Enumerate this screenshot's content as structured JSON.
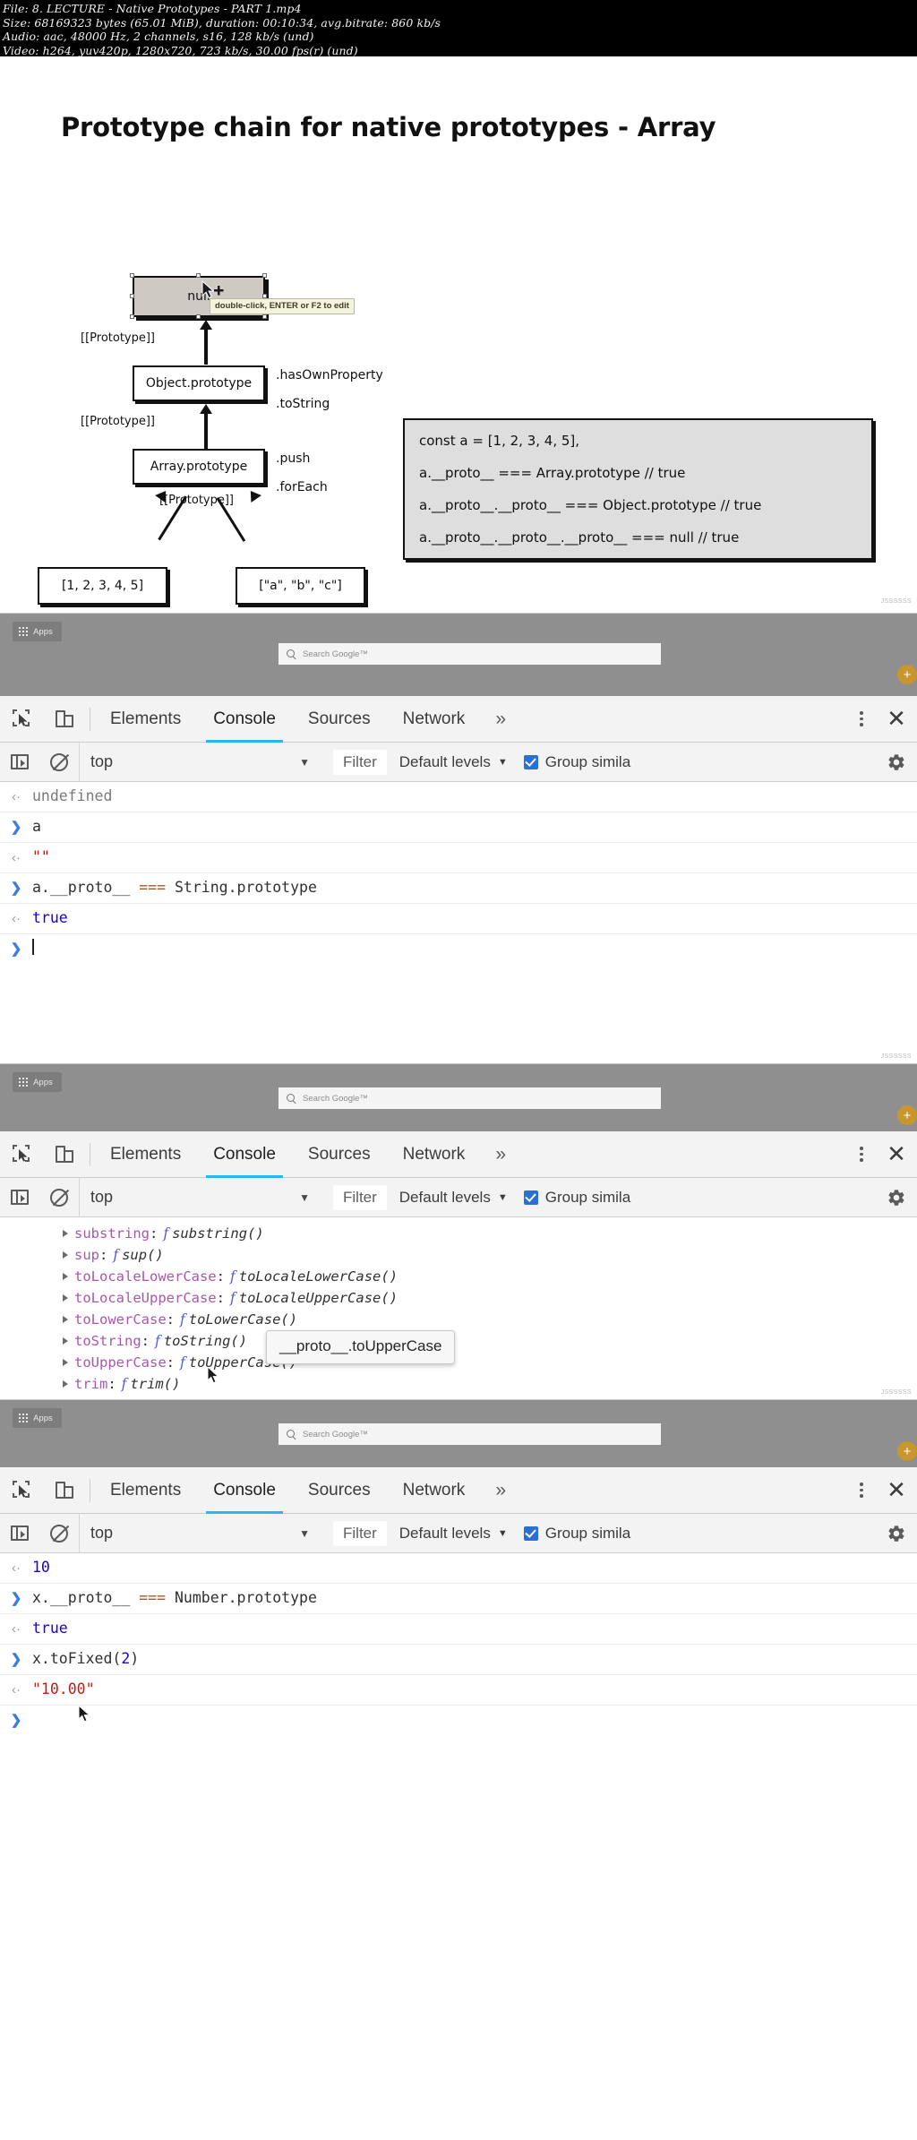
{
  "fileinfo": {
    "line1": "File: 8. LECTURE - Native Prototypes - PART 1.mp4",
    "line2": "Size: 68169323 bytes (65.01 MiB), duration: 00:10:34, avg.bitrate: 860 kb/s",
    "line3": "Audio: aac, 48000 Hz, 2 channels, s16, 128 kb/s (und)",
    "line4": "Video: h264, yuv420p, 1280x720, 723 kb/s, 30.00 fps(r) (und)"
  },
  "slide": {
    "title": "Prototype chain for native prototypes - Array",
    "boxes": {
      "null": "null",
      "object_prototype": "Object.prototype",
      "array_prototype": "Array.prototype",
      "array_numbers": "[1, 2, 3, 4, 5]",
      "array_strings": "[\"a\", \"b\", \"c\"]"
    },
    "edges": {
      "proto1": "[[Prototype]]",
      "proto2": "[[Prototype]]",
      "proto3": "[[Prototype]]"
    },
    "methods": {
      "has_own_property": ".hasOwnProperty",
      "to_string": ".toString",
      "push": ".push",
      "for_each": ".forEach"
    },
    "tooltip": "double-click, ENTER or F2 to edit",
    "code_lines": [
      "const a = [1, 2, 3, 4, 5],",
      "a.__proto__ === Array.prototype // true",
      "a.__proto__.__proto__ === Object.prototype // true",
      "a.__proto__.__proto__.__proto__ === null // true"
    ],
    "watermark": "JSSSSSS"
  },
  "browser": {
    "apps_label": "Apps",
    "search_placeholder": "Search Google™"
  },
  "devtools": {
    "tabs": [
      "Elements",
      "Console",
      "Sources",
      "Network"
    ],
    "active_tab": "Console",
    "more_tabs": "»",
    "context": "top",
    "filter_placeholder": "Filter",
    "levels": "Default levels",
    "group_similar": "Group simila",
    "caret": "▼"
  },
  "console1": {
    "rows": [
      {
        "dir": "out",
        "segments": [
          {
            "text": "undefined",
            "cls": "t-undef"
          }
        ]
      },
      {
        "dir": "in",
        "segments": [
          {
            "text": "a",
            "cls": ""
          }
        ]
      },
      {
        "dir": "out",
        "segments": [
          {
            "text": "\"\"",
            "cls": "t-str"
          }
        ]
      },
      {
        "dir": "in",
        "segments": [
          {
            "text": "a.__proto__ ",
            "cls": ""
          },
          {
            "text": "===",
            "cls": "t-op"
          },
          {
            "text": " String.prototype",
            "cls": ""
          }
        ]
      },
      {
        "dir": "out",
        "segments": [
          {
            "text": "true",
            "cls": "t-bool"
          }
        ]
      },
      {
        "dir": "prompt",
        "segments": []
      }
    ]
  },
  "console2": {
    "properties": [
      {
        "key": "substring",
        "fn": "substring()"
      },
      {
        "key": "sup",
        "fn": "sup()"
      },
      {
        "key": "toLocaleLowerCase",
        "fn": "toLocaleLowerCase()"
      },
      {
        "key": "toLocaleUpperCase",
        "fn": "toLocaleUpperCase()"
      },
      {
        "key": "toLowerCase",
        "fn": "toLowerCase()"
      },
      {
        "key": "toString",
        "fn": "toString()"
      },
      {
        "key": "toUpperCase",
        "fn": "toUpperCase()"
      },
      {
        "key": "trim",
        "fn": "trim()"
      }
    ],
    "f_glyph": "f",
    "tooltip": "__proto__.toUpperCase"
  },
  "console3": {
    "rows": [
      {
        "dir": "out",
        "segments": [
          {
            "text": "10",
            "cls": "t-num"
          }
        ]
      },
      {
        "dir": "in",
        "segments": [
          {
            "text": "x.__proto__ ",
            "cls": ""
          },
          {
            "text": "===",
            "cls": "t-op"
          },
          {
            "text": " Number.prototype",
            "cls": ""
          }
        ]
      },
      {
        "dir": "out",
        "segments": [
          {
            "text": "true",
            "cls": "t-bool"
          }
        ]
      },
      {
        "dir": "in",
        "segments": [
          {
            "text": "x.toFixed(",
            "cls": ""
          },
          {
            "text": "2",
            "cls": "t-num"
          },
          {
            "text": ")",
            "cls": ""
          }
        ]
      },
      {
        "dir": "out",
        "segments": [
          {
            "text": "\"10.00\"",
            "cls": "t-str"
          }
        ]
      },
      {
        "dir": "prompt",
        "segments": []
      }
    ]
  },
  "icons": {
    "gutter_in": ">",
    "gutter_out": "‹·",
    "prompt": ">"
  },
  "colors": {
    "accent_tab": "#29b6f6",
    "checkbox": "#2a6fd6",
    "string": "#c41a16",
    "boolean": "#1c00cf",
    "operator": "#a05a2c",
    "property_key": "#a957a9"
  }
}
